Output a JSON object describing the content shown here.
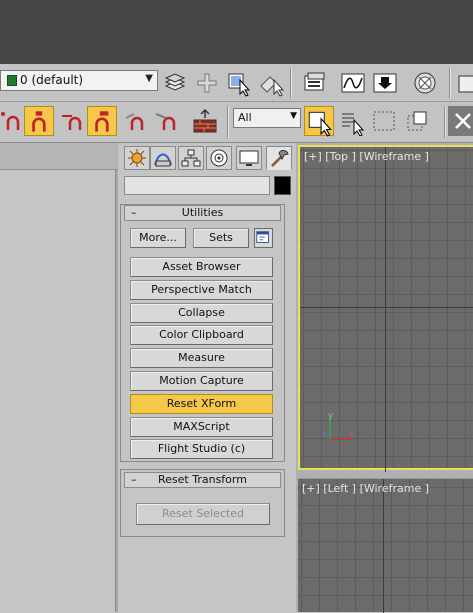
{
  "toolbar": {
    "layer_name": "0 (default)",
    "layer_color": "#1b7a2c",
    "selection_filter": "All",
    "icons": [
      "layer-stack-icon",
      "create-plus-icon",
      "select-object-icon",
      "select-by-name-icon",
      "render-setup-icon",
      "curve-editor-icon",
      "render-frame-icon",
      "material-editor-icon",
      "link-icon",
      "unlink-icon",
      "bind-spacewarp-icon",
      "select-region-icon",
      "window-crossing-icon",
      "close-icon"
    ]
  },
  "command_panel": {
    "tabs": [
      "create-tab",
      "modify-tab",
      "hierarchy-tab",
      "motion-tab",
      "display-tab",
      "utilities-tab"
    ],
    "active_tab": "utilities-tab",
    "object_name": "",
    "object_color": "#000000",
    "utilities": {
      "title": "Utilities",
      "more_label": "More...",
      "sets_label": "Sets",
      "items": [
        {
          "label": "Asset Browser"
        },
        {
          "label": "Perspective Match"
        },
        {
          "label": "Collapse"
        },
        {
          "label": "Color Clipboard"
        },
        {
          "label": "Measure"
        },
        {
          "label": "Motion Capture"
        },
        {
          "label": "Reset XForm",
          "active": true
        },
        {
          "label": "MAXScript"
        },
        {
          "label": "Flight Studio (c)"
        }
      ]
    },
    "reset_transform": {
      "title": "Reset Transform",
      "button_label": "Reset Selected"
    }
  },
  "viewports": {
    "top_label": "[+] [Top ] [Wireframe ]",
    "left_label": "[+] [Left ] [Wireframe ]",
    "axis_x": "x",
    "axis_y": "y",
    "axis_z": "z",
    "active_border_color": "#e9e15b"
  }
}
